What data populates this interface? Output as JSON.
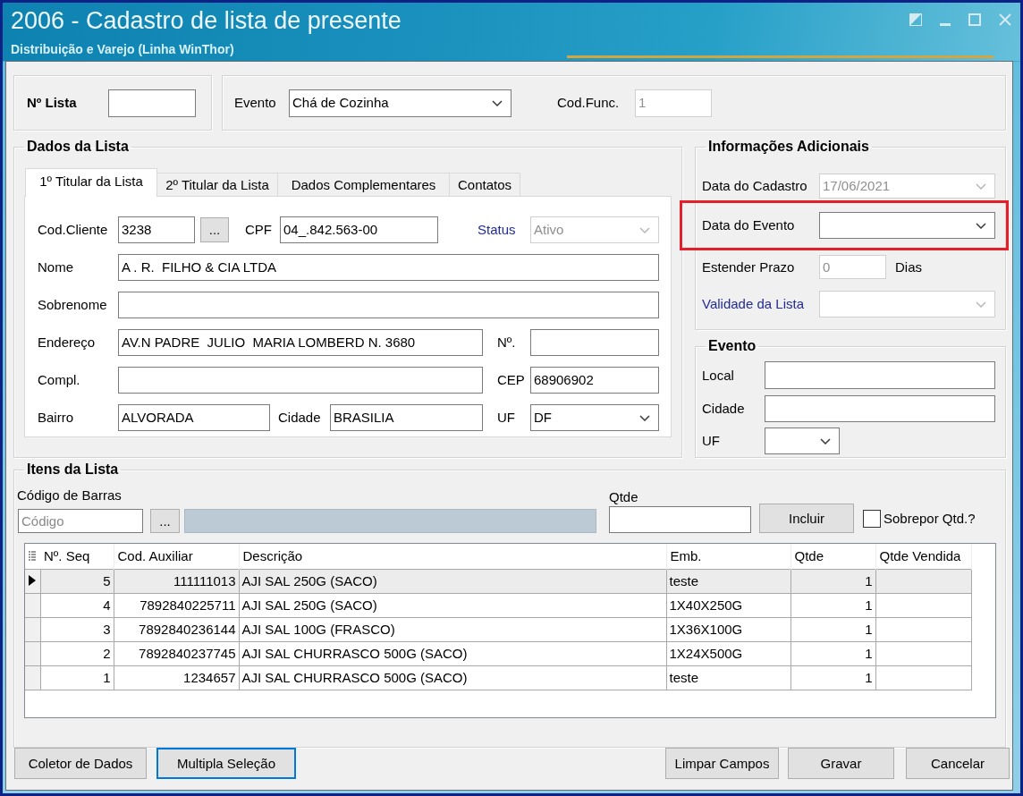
{
  "window": {
    "title": "2006 - Cadastro de lista de presente",
    "subtitle": "Distribuição e Varejo (Linha WinThor)"
  },
  "header": {
    "list_number": {
      "label": "Nº Lista"
    },
    "event": {
      "label": "Evento",
      "value": "Chá de Cozinha"
    },
    "employee_code": {
      "label": "Cod.Func.",
      "value": "1",
      "disabled": true
    }
  },
  "list_data": {
    "title": "Dados da Lista",
    "tabs": [
      {
        "label": "1º Titular da Lista",
        "selected": true
      },
      {
        "label": "2º Titular da Lista",
        "selected": false
      },
      {
        "label": "Dados Complementares",
        "selected": false
      },
      {
        "label": "Contatos",
        "selected": false
      }
    ],
    "fields": [
      {
        "kind": "text",
        "label": "Cod.Cliente",
        "value": "3238",
        "disabled": false,
        "link": false
      },
      {
        "kind": "button",
        "label": "...",
        "disabled": false
      },
      {
        "kind": "text",
        "label": "CPF",
        "value": "04_.842.563-00",
        "disabled": false,
        "link": false
      },
      {
        "kind": "combo",
        "label": "Status",
        "value": "Ativo",
        "disabled": true,
        "link": true
      },
      {
        "kind": "text",
        "label": "Nome",
        "value": "A . R.  FILHO & CIA LTDA",
        "disabled": false,
        "link": false
      },
      {
        "kind": "text",
        "label": "Sobrenome",
        "disabled": false,
        "link": false
      },
      {
        "kind": "text",
        "label": "Endereço",
        "value": "AV.N PADRE  JULIO  MARIA LOMBERD N. 3680",
        "disabled": false,
        "link": false
      },
      {
        "kind": "text",
        "label": "Nº.",
        "disabled": false,
        "link": false
      },
      {
        "kind": "text",
        "label": "Compl.",
        "disabled": false,
        "link": false
      },
      {
        "kind": "text",
        "label": "CEP",
        "value": "68906902",
        "disabled": false,
        "link": false
      },
      {
        "kind": "text",
        "label": "Bairro",
        "value": "ALVORADA",
        "disabled": false,
        "link": false
      },
      {
        "kind": "text",
        "label": "Cidade",
        "value": "BRASILIA",
        "disabled": false,
        "link": false
      },
      {
        "kind": "combo",
        "label": "UF",
        "value": "DF",
        "disabled": false,
        "link": false
      }
    ]
  },
  "additional_info": {
    "title": "Informações Adicionais",
    "fields": [
      {
        "kind": "combo",
        "label": "Data do Cadastro",
        "value": "17/06/2021",
        "disabled": true,
        "link": false,
        "highlighted": false
      },
      {
        "kind": "combo",
        "label": "Data do Evento",
        "disabled": false,
        "link": false,
        "highlighted": true
      },
      {
        "kind": "text",
        "label": "Estender Prazo",
        "value": "0",
        "unit": "Dias",
        "disabled": true,
        "link": false,
        "highlighted": false
      },
      {
        "kind": "combo",
        "label": "Validade da Lista",
        "disabled": true,
        "link": true,
        "highlighted": false
      }
    ]
  },
  "event_place": {
    "title": "Evento",
    "fields": [
      {
        "kind": "text",
        "label": "Local",
        "disabled": false
      },
      {
        "kind": "text",
        "label": "Cidade",
        "disabled": false
      },
      {
        "kind": "combo",
        "label": "UF",
        "disabled": false
      }
    ]
  },
  "items": {
    "title": "Itens da Lista",
    "barcode": {
      "label": "Código de Barras",
      "placeholder": "Código"
    },
    "lookup_button": "...",
    "quantity": {
      "label": "Qtde"
    },
    "add_button": "Incluir",
    "overwrite": {
      "label": "Sobrepor Qtd.?",
      "checked": false
    },
    "table": {
      "columns": [
        "Nº. Seq",
        "Cod. Auxiliar",
        "Descrição",
        "Emb.",
        "Qtde",
        "Qtde Vendida"
      ],
      "rows": [
        {
          "selected": true,
          "cells": [
            "5",
            "111111013",
            "AJI SAL 250G (SACO)",
            "teste",
            "1"
          ]
        },
        {
          "selected": false,
          "cells": [
            "4",
            "7892840225711",
            "AJI SAL 250G (SACO)",
            "1X40X250G",
            "1"
          ]
        },
        {
          "selected": false,
          "cells": [
            "3",
            "7892840236144",
            "AJI SAL 100G (FRASCO)",
            "1X36X100G",
            "1"
          ]
        },
        {
          "selected": false,
          "cells": [
            "2",
            "7892840237745",
            "AJI SAL CHURRASCO 500G (SACO)",
            "1X24X500G",
            "1"
          ]
        },
        {
          "selected": false,
          "cells": [
            "1",
            "1234657",
            "AJI SAL CHURRASCO 500G (SACO)",
            "teste",
            "1"
          ]
        }
      ]
    }
  },
  "footer": {
    "left_buttons": [
      {
        "label": "Coletor de Dados",
        "focused": false
      },
      {
        "label": "Multipla Seleção",
        "focused": true
      }
    ],
    "right_buttons": [
      {
        "label": "Limpar Campos",
        "focused": false
      },
      {
        "label": "Gravar",
        "focused": false
      },
      {
        "label": "Cancelar",
        "focused": false
      }
    ]
  }
}
